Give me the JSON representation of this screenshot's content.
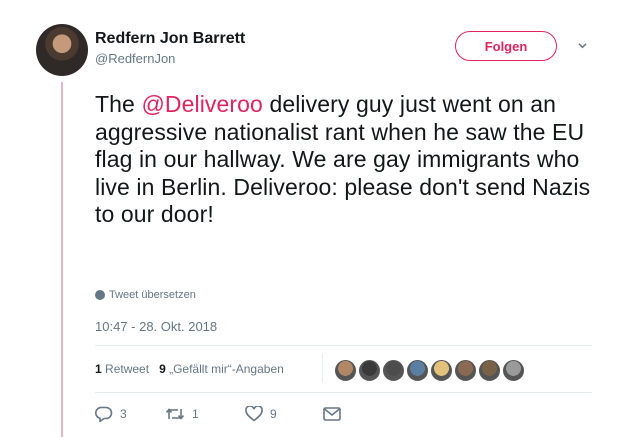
{
  "user": {
    "name": "Redfern Jon Barrett",
    "handle": "@RedfernJon"
  },
  "follow_label": "Folgen",
  "tweet": {
    "mention": "@Deliveroo",
    "text_before": "The ",
    "text_after": " delivery guy just went on an aggressive nationalist rant when he saw the EU flag in our hallway. We are gay immigrants who live in Berlin. Deliveroo: please don't send Nazis to our door!"
  },
  "translate_label": "Tweet übersetzen",
  "timestamp": "10:47 - 28. Okt. 2018",
  "stats": {
    "retweets_count": "1",
    "retweets_label": "Retweet",
    "likes_count": "9",
    "likes_label": "„Gefällt mir“-Angaben"
  },
  "liker_avatars": [
    "#b08866",
    "#3a3a3a",
    "#4d4d4d",
    "#5b7fa3",
    "#e2c27a",
    "#8a6a55",
    "#7a6248",
    "#9a9a9a"
  ],
  "actions": {
    "reply_count": "3",
    "retweet_count": "1",
    "like_count": "9"
  },
  "colors": {
    "accent": "#e0245e",
    "muted": "#657786",
    "text": "#14171a"
  }
}
